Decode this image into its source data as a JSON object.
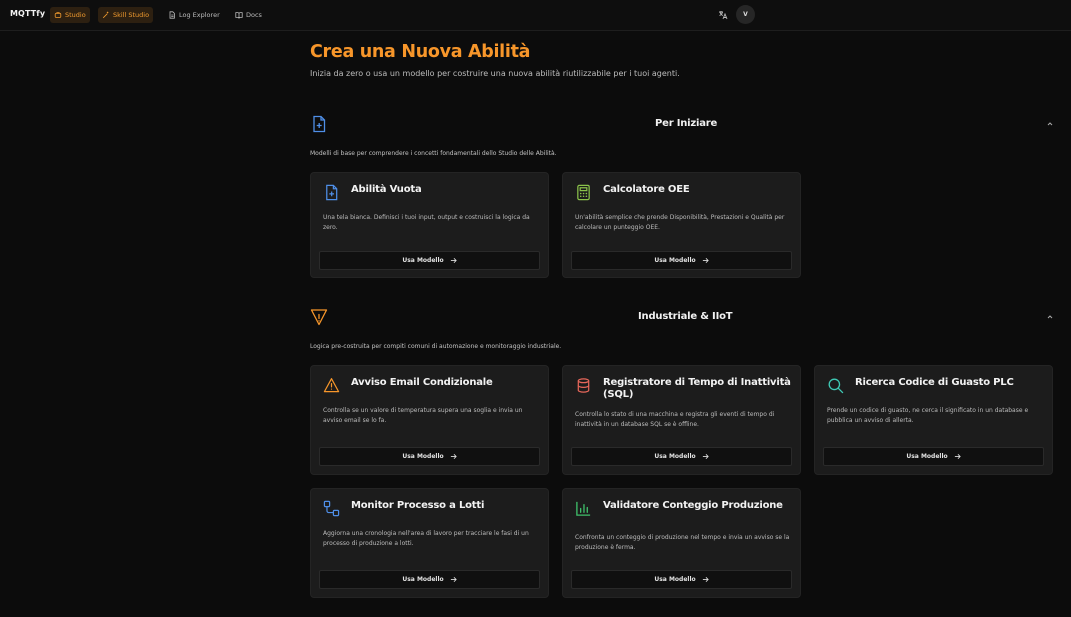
{
  "app": {
    "brand": "MQTTfy",
    "nav": [
      {
        "label": "Studio",
        "icon": "studio-icon",
        "active": true
      },
      {
        "label": "Skill Studio",
        "icon": "wand-icon",
        "active": true
      },
      {
        "label": "Log Explorer",
        "icon": "document-icon",
        "active": false
      },
      {
        "label": "Docs",
        "icon": "book-icon",
        "active": false
      }
    ],
    "translate_icon": "translate-icon",
    "avatar_initial": "V"
  },
  "page": {
    "title": "Crea una Nuova Abilità",
    "subtitle": "Inizia da zero o usa un modello per costruire una nuova abilità riutilizzabile per i tuoi agenti."
  },
  "colors": {
    "accent": "#f7962a",
    "blue": "#4f8fe8",
    "green": "#8bc34a",
    "red": "#e5665a",
    "teal": "#3fc9b4",
    "emerald": "#3fbf6a"
  },
  "sections": [
    {
      "title": "Per Iniziare",
      "icon": "file-plus-icon",
      "description": "Modelli di base per comprendere i concetti fondamentali dello Studio delle Abilità.",
      "cards": [
        {
          "title": "Abilità Vuota",
          "icon": "file-plus-icon",
          "description": "Una tela bianca. Definisci i tuoi input, output e costruisci la logica da zero.",
          "button": "Usa Modello"
        },
        {
          "title": "Calcolatore OEE",
          "icon": "calculator-icon",
          "description": "Un'abilità semplice che prende Disponibilità, Prestazioni e Qualità per calcolare un punteggio OEE.",
          "button": "Usa Modello"
        }
      ]
    },
    {
      "title": "Industriale & IIoT",
      "icon": "factory-icon",
      "description": "Logica pre-costruita per compiti comuni di automazione e monitoraggio industriale.",
      "cards": [
        {
          "title": "Avviso Email Condizionale",
          "icon": "warning-icon",
          "description": "Controlla se un valore di temperatura supera una soglia e invia un avviso email se lo fa.",
          "button": "Usa Modello"
        },
        {
          "title": "Registratore di Tempo di Inattività (SQL)",
          "icon": "database-icon",
          "description": "Controlla lo stato di una macchina e registra gli eventi di tempo di inattività in un database SQL se è offline.",
          "button": "Usa Modello"
        },
        {
          "title": "Ricerca Codice di Guasto PLC",
          "icon": "search-icon",
          "description": "Prende un codice di guasto, ne cerca il significato in un database e pubblica un avviso di allerta.",
          "button": "Usa Modello"
        },
        {
          "title": "Monitor Processo a Lotti",
          "icon": "workflow-icon",
          "description": "Aggiorna una cronologia nell'area di lavoro per tracciare le fasi di un processo di produzione a lotti.",
          "button": "Usa Modello"
        },
        {
          "title": "Validatore Conteggio Produzione",
          "icon": "bar-chart-icon",
          "description": "Confronta un conteggio di produzione nel tempo e invia un avviso se la produzione è ferma.",
          "button": "Usa Modello"
        }
      ]
    }
  ]
}
